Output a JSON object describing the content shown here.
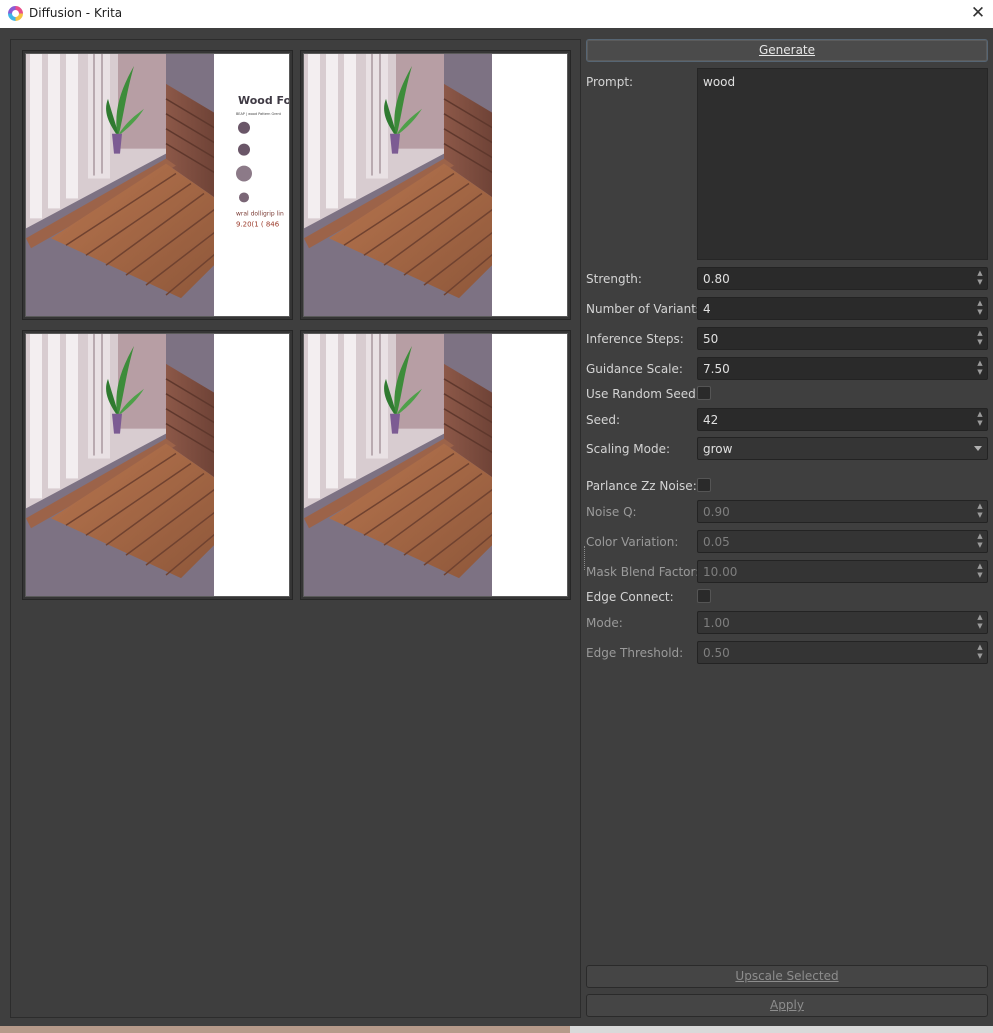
{
  "window": {
    "title": "Diffusion - Krita",
    "close_glyph": "✕"
  },
  "thumbnails": [
    {
      "name": "variant-1",
      "overlay_text": {
        "heading": "Wood Fo",
        "small": "BEAP | wood Pattern Grent",
        "line1": "wral dolligrip lin",
        "line2": "9.20(1 ( 846"
      }
    },
    {
      "name": "variant-2"
    },
    {
      "name": "variant-3"
    },
    {
      "name": "variant-4"
    }
  ],
  "form": {
    "generate_label": "Generate",
    "prompt_label": "Prompt:",
    "prompt_value": "wood",
    "strength_label": "Strength:",
    "strength_value": "0.80",
    "variants_label": "Number of Variants:",
    "variants_value": "4",
    "steps_label": "Inference Steps:",
    "steps_value": "50",
    "guidance_label": "Guidance Scale:",
    "guidance_value": "7.50",
    "random_seed_label": "Use Random Seed:",
    "random_seed_checked": false,
    "seed_label": "Seed:",
    "seed_value": "42",
    "scaling_label": "Scaling Mode:",
    "scaling_value": "grow",
    "noise_label": "Parlance Zz Noise:",
    "noise_checked": false,
    "noise_q_label": "Noise Q:",
    "noise_q_value": "0.90",
    "color_var_label": "Color Variation:",
    "color_var_value": "0.05",
    "mask_blend_label": "Mask Blend Factor:",
    "mask_blend_value": "10.00",
    "edge_connect_label": "Edge Connect:",
    "edge_connect_checked": false,
    "mode_label": "Mode:",
    "mode_value": "1.00",
    "edge_threshold_label": "Edge Threshold:",
    "edge_threshold_value": "0.50",
    "upscale_label": "Upscale Selected",
    "apply_label": "Apply"
  },
  "colors": {
    "background": "#3f3f3f",
    "field": "#2a2a2a",
    "accent_border": "#566573"
  }
}
